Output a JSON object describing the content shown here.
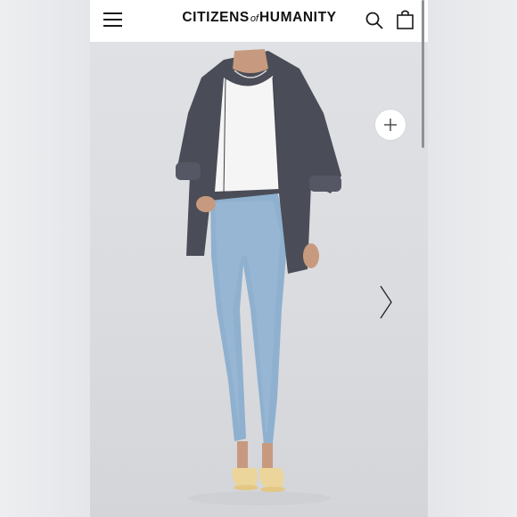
{
  "header": {
    "brand_left": "CITIZENS",
    "brand_of": "of",
    "brand_right": "HUMANITY"
  },
  "icons": {
    "menu": "hamburger-menu-icon",
    "search": "search-icon",
    "bag": "shopping-bag-icon",
    "zoom": "plus-icon",
    "next": "chevron-right-icon"
  },
  "product_image": {
    "description_shown": "model wearing oversized charcoal button-up shirt, white tank, light wash skinny jeans, yellow slide sandals"
  },
  "colors": {
    "header_bg": "#ffffff",
    "photo_bg": "#dcdee2",
    "shirt": "#4a4d57",
    "denim": "#8fb0cf",
    "sandal": "#ecd59b"
  }
}
